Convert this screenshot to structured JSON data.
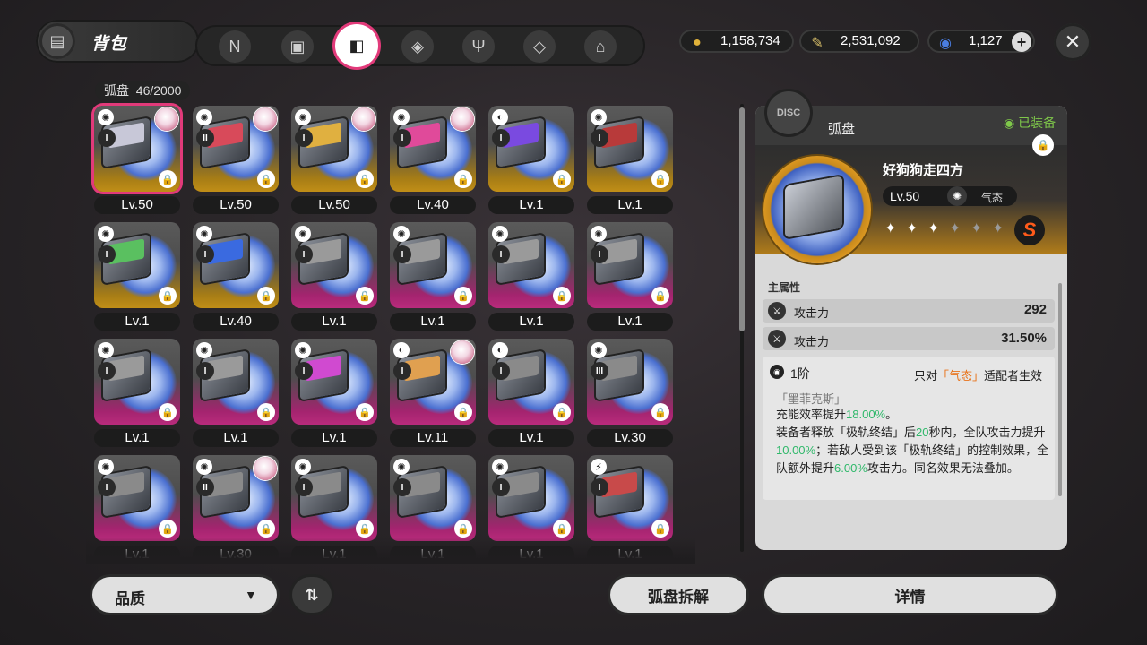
{
  "header": {
    "title": "背包",
    "tabs": [
      {
        "icon": "n-logo-icon",
        "glyph": "N"
      },
      {
        "icon": "handheld-console-icon",
        "glyph": "▣"
      },
      {
        "icon": "disc-case-icon",
        "glyph": "◧",
        "active": true
      },
      {
        "icon": "box-icon",
        "glyph": "◈"
      },
      {
        "icon": "fork-knife-icon",
        "glyph": "Ψ"
      },
      {
        "icon": "material-icon",
        "glyph": "◇"
      },
      {
        "icon": "home-icon",
        "glyph": "⌂"
      }
    ],
    "currencies": [
      {
        "icon": "gold-coin-icon",
        "glyph": "●",
        "color": "#e0b23a",
        "value": "1,158,734"
      },
      {
        "icon": "ticket-icon",
        "glyph": "✎",
        "color": "#d9c06a",
        "value": "2,531,092"
      },
      {
        "icon": "polychrome-icon",
        "glyph": "◉",
        "color": "#4a7de0",
        "value": "1,127"
      }
    ]
  },
  "inventory": {
    "label": "弧盘",
    "count": "46/2000",
    "items": [
      {
        "level": "Lv.50",
        "rank": "I",
        "bg": "gold",
        "art": "#c8c8d8",
        "avatar": true,
        "selected": true
      },
      {
        "level": "Lv.50",
        "rank": "II",
        "bg": "gold",
        "art": "#d84a5a",
        "avatar": true
      },
      {
        "level": "Lv.50",
        "rank": "I",
        "bg": "gold",
        "art": "#e0b040",
        "avatar": true
      },
      {
        "level": "Lv.40",
        "rank": "I",
        "bg": "gold",
        "art": "#e04a9a",
        "avatar": true
      },
      {
        "level": "Lv.1",
        "rank": "I",
        "bg": "gold",
        "art": "#7a4ae0",
        "avatar": false
      },
      {
        "level": "Lv.1",
        "rank": "I",
        "bg": "gold",
        "art": "#b83a3a",
        "avatar": false
      },
      {
        "level": "Lv.1",
        "rank": "I",
        "bg": "gold",
        "art": "#5ac060",
        "avatar": false
      },
      {
        "level": "Lv.40",
        "rank": "I",
        "bg": "gold",
        "art": "#3a6ae0",
        "avatar": false
      },
      {
        "level": "Lv.1",
        "rank": "I",
        "bg": "pink",
        "art": "#9a9a9a",
        "avatar": false
      },
      {
        "level": "Lv.1",
        "rank": "I",
        "bg": "pink",
        "art": "#9a9a9a",
        "avatar": false
      },
      {
        "level": "Lv.1",
        "rank": "I",
        "bg": "pink",
        "art": "#9a9a9a",
        "avatar": false
      },
      {
        "level": "Lv.1",
        "rank": "I",
        "bg": "pink",
        "art": "#9a9a9a",
        "avatar": false
      },
      {
        "level": "Lv.1",
        "rank": "I",
        "bg": "pink",
        "art": "#9a9a9a",
        "avatar": false
      },
      {
        "level": "Lv.1",
        "rank": "I",
        "bg": "pink",
        "art": "#9a9a9a",
        "avatar": false
      },
      {
        "level": "Lv.1",
        "rank": "I",
        "bg": "pink",
        "art": "#d04ad0",
        "avatar": false
      },
      {
        "level": "Lv.11",
        "rank": "I",
        "bg": "pink",
        "art": "#e0a050",
        "avatar": true
      },
      {
        "level": "Lv.1",
        "rank": "I",
        "bg": "pink",
        "art": "#8a8a8a",
        "avatar": false
      },
      {
        "level": "Lv.30",
        "rank": "III",
        "bg": "pink",
        "art": "#8a8a8a",
        "avatar": false
      },
      {
        "level": "Lv.1",
        "rank": "I",
        "bg": "pink",
        "art": "#8a8a8a",
        "avatar": false
      },
      {
        "level": "Lv.30",
        "rank": "II",
        "bg": "pink",
        "art": "#8a8a8a",
        "avatar": true
      },
      {
        "level": "Lv.1",
        "rank": "I",
        "bg": "pink",
        "art": "#8a8a8a",
        "avatar": false
      },
      {
        "level": "Lv.1",
        "rank": "I",
        "bg": "pink",
        "art": "#8a8a8a",
        "avatar": false
      },
      {
        "level": "Lv.1",
        "rank": "I",
        "bg": "pink",
        "art": "#8a8a8a",
        "avatar": false
      },
      {
        "level": "Lv.1",
        "rank": "I",
        "bg": "pink",
        "art": "#c84a4a",
        "avatar": false
      }
    ]
  },
  "detail": {
    "panel_title": "弧盘",
    "equipped": "◉ 已装备",
    "name": "好狗狗走四方",
    "level": "Lv.50",
    "attribute": "气态",
    "stars_on": 3,
    "stars_total": 6,
    "grade": "S",
    "main_attr_label": "主属性",
    "stats": [
      {
        "name": "攻击力",
        "value": "292"
      },
      {
        "name": "攻击力",
        "value": "31.50%"
      }
    ],
    "skill": {
      "tier": "1阶",
      "cond_prefix": "只对",
      "cond_highlight": "「气态」",
      "cond_suffix": "适配者生效",
      "name": "「墨菲克斯」",
      "desc_1": "充能效率提升",
      "desc_1_val": "18.00%",
      "desc_1_end": "。",
      "desc_2": "装备者释放「极轨终结」后",
      "desc_2_val": "20",
      "desc_2_end": "秒内，全队攻击力提升",
      "desc_3_val": "10.00%",
      "desc_3_end": "；若敌人受到该「极轨终结」的控制效果，全队额外提升",
      "desc_4_val": "6.00%",
      "desc_4_end": "攻击力。同名效果无法叠加。"
    }
  },
  "footer": {
    "quality_label": "品质",
    "sort_glyph": "⇅",
    "dismantle_label": "弧盘拆解",
    "details_label": "详情"
  }
}
